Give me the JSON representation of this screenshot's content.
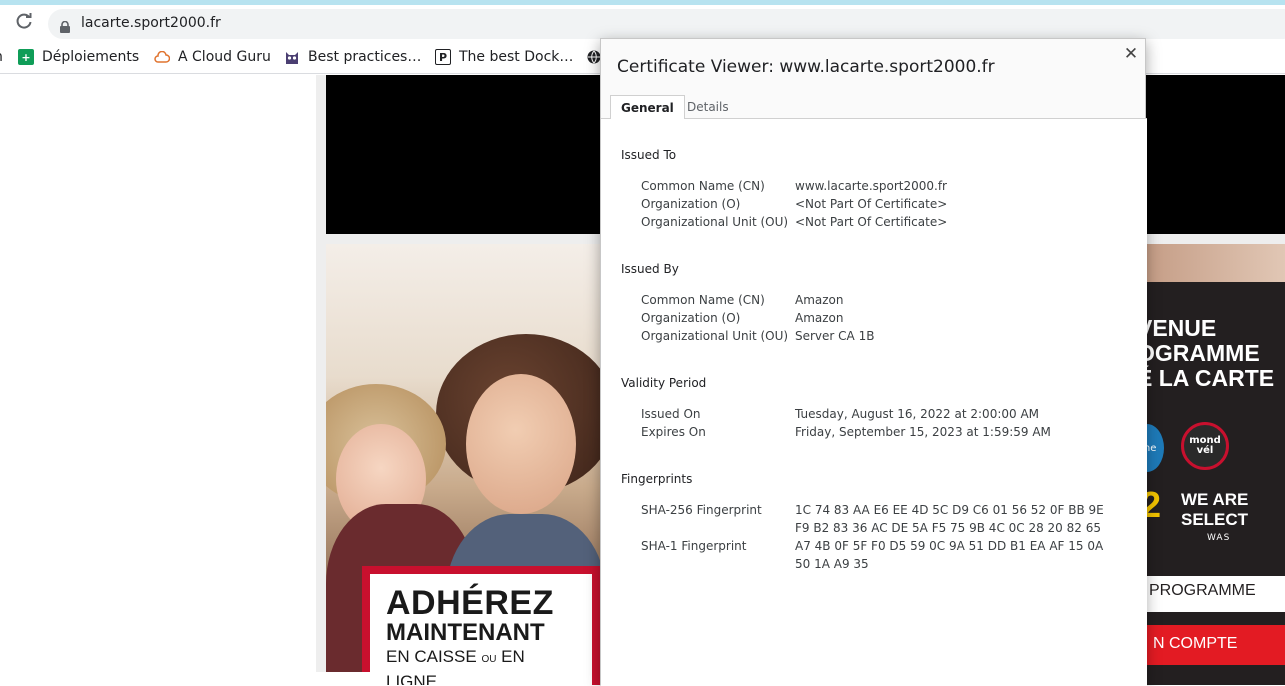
{
  "browser": {
    "url": "lacarte.sport2000.fr",
    "bookmarks": [
      {
        "label": "Déploiements",
        "icon": "plus-icon"
      },
      {
        "label": "A Cloud Guru",
        "icon": "cloud-icon"
      },
      {
        "label": "Best practices…",
        "icon": "owl-icon"
      },
      {
        "label": "The best Dock…",
        "icon": "p-icon"
      }
    ]
  },
  "page": {
    "promo": {
      "line1": "ADHÉREZ",
      "line2": "MAINTENANT",
      "line3a": "EN CAISSE",
      "line3b": "OU",
      "line3c": "EN LIGNE"
    },
    "right": {
      "title_lines": [
        "VENUE",
        "OGRAMME",
        "É LA CARTE"
      ],
      "badge_blue": "gne",
      "badge_red": "mond vél",
      "num": "2",
      "select_line1": "WE ARE",
      "select_line2": "SELECT",
      "was": "WAS",
      "programme": "PROGRAMME",
      "compte": "N COMPTE"
    }
  },
  "dialog": {
    "title": "Certificate Viewer: www.lacarte.sport2000.fr",
    "tabs": [
      "General",
      "Details"
    ],
    "active_tab": "General",
    "issued_to": {
      "heading": "Issued To",
      "rows": [
        {
          "label": "Common Name (CN)",
          "value": "www.lacarte.sport2000.fr"
        },
        {
          "label": "Organization (O)",
          "value": "<Not Part Of Certificate>"
        },
        {
          "label": "Organizational Unit (OU)",
          "value": "<Not Part Of Certificate>"
        }
      ]
    },
    "issued_by": {
      "heading": "Issued By",
      "rows": [
        {
          "label": "Common Name (CN)",
          "value": "Amazon"
        },
        {
          "label": "Organization (O)",
          "value": "Amazon"
        },
        {
          "label": "Organizational Unit (OU)",
          "value": "Server CA 1B"
        }
      ]
    },
    "validity": {
      "heading": "Validity Period",
      "rows": [
        {
          "label": "Issued On",
          "value": "Tuesday, August 16, 2022 at 2:00:00 AM"
        },
        {
          "label": "Expires On",
          "value": "Friday, September 15, 2023 at 1:59:59 AM"
        }
      ]
    },
    "fingerprints": {
      "heading": "Fingerprints",
      "sha256_label": "SHA-256 Fingerprint",
      "sha256_line1": "1C 74 83 AA E6 EE 4D 5C D9 C6 01 56 52 0F BB 9E",
      "sha256_line2": "F9 B2 83 36 AC DE 5A F5 75 9B 4C 0C 28 20 82 65",
      "sha1_label": "SHA-1 Fingerprint",
      "sha1_line1": "A7 4B 0F 5F F0 D5 59 0C 9A 51 DD B1 EA AF 15 0A",
      "sha1_line2": "50 1A A9 35"
    }
  }
}
